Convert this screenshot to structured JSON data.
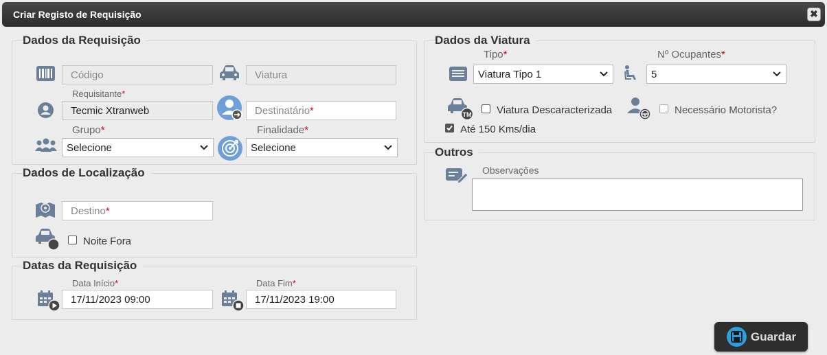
{
  "window": {
    "title": "Criar Registo de Requisição",
    "close_label": "✖"
  },
  "requisicao": {
    "legend": "Dados da Requisição",
    "codigo_placeholder": "Código",
    "viatura_placeholder": "Viatura",
    "requisitante_label": "Requisitante",
    "requisitante_value": "Tecmic Xtranweb",
    "destinatario_placeholder": "Destinatário",
    "grupo_label": "Grupo",
    "grupo_value": "Selecione",
    "finalidade_label": "Finalidade",
    "finalidade_value": "Selecione",
    "required_mark": "*"
  },
  "localizacao": {
    "legend": "Dados de Localização",
    "destino_placeholder": "Destino",
    "noite_fora_label": "Noite Fora",
    "noite_fora_checked": false
  },
  "datas": {
    "legend": "Datas da Requisição",
    "inicio_label": "Data Início",
    "inicio_value": "17/11/2023 09:00",
    "fim_label": "Data Fim",
    "fim_value": "17/11/2023 19:00"
  },
  "viatura": {
    "legend": "Dados da Viatura",
    "tipo_label": "Tipo",
    "tipo_value": "Viatura Tipo 1",
    "ocupantes_label": "Nº Ocupantes",
    "ocupantes_value": "5",
    "descaracterizada_label": "Viatura Descaracterizada",
    "descaracterizada_checked": false,
    "motorista_label": "Necessário Motorista?",
    "motorista_checked": false,
    "kms_label": "Até 150 Kms/dia",
    "kms_checked": true
  },
  "outros": {
    "legend": "Outros",
    "observacoes_label": "Observações",
    "observacoes_value": ""
  },
  "actions": {
    "save_label": "Guardar"
  },
  "colors": {
    "icon": "#6b7f99",
    "accent": "#2aa0e0",
    "required": "#d0021b",
    "titlebar": "#2c2c2c"
  }
}
